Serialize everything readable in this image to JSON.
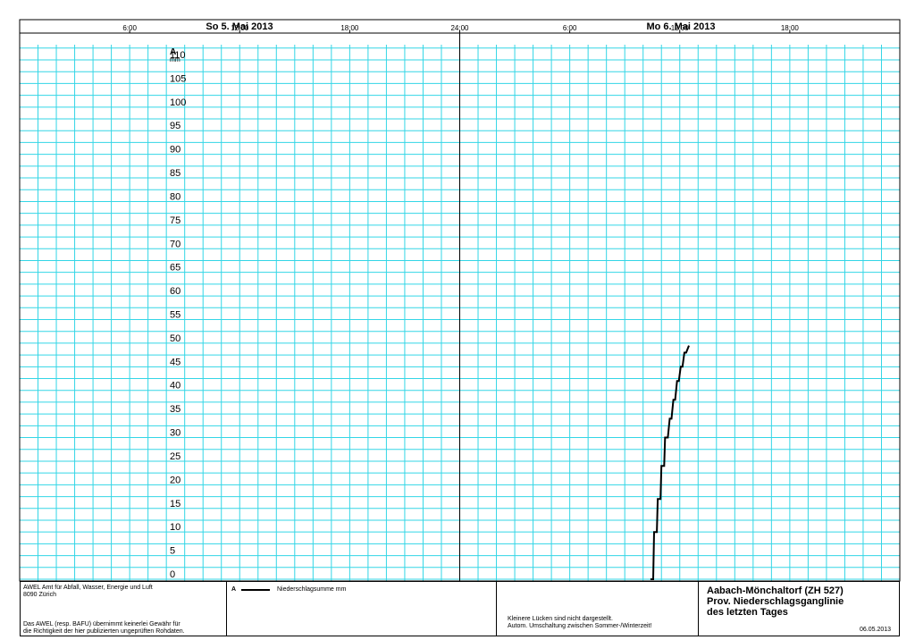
{
  "header": {
    "day1": "So  5. Mai  2013",
    "day2": "Mo  6. Mai  2013",
    "time_labels": [
      "6:00",
      "12:00",
      "18:00",
      "24:00",
      "6:00",
      "12:00",
      "18:00"
    ]
  },
  "colors": {
    "grid": "#33d6e6",
    "line": "#000000"
  },
  "chart_data": {
    "type": "line",
    "series": [
      {
        "name": "Niederschlagsumme mm",
        "x_hours_from_start": [
          34.4,
          34.55,
          34.6,
          34.75,
          34.8,
          34.95,
          35.0,
          35.15,
          35.2,
          35.35,
          35.45,
          35.55,
          35.65,
          35.75,
          35.85,
          35.95,
          36.05,
          36.15,
          36.25,
          36.35,
          36.5
        ],
        "values": [
          0,
          0,
          10,
          10,
          17,
          17,
          24,
          24,
          30,
          30,
          34,
          34,
          38,
          38,
          42,
          42,
          45,
          45,
          48,
          48,
          49.5
        ]
      }
    ],
    "x_range_hours": [
      0,
      48
    ],
    "ylim": [
      0,
      110
    ],
    "ytick_values": [
      0,
      5,
      10,
      15,
      20,
      25,
      30,
      35,
      40,
      45,
      50,
      55,
      60,
      65,
      70,
      75,
      80,
      85,
      90,
      95,
      100,
      105,
      110
    ],
    "ytick_labels": [
      "0",
      "5",
      "10",
      "15",
      "20",
      "25",
      "30",
      "35",
      "40",
      "45",
      "50",
      "55",
      "60",
      "65",
      "70",
      "75",
      "80",
      "85",
      "90",
      "95",
      "100",
      "105",
      "110"
    ],
    "axis_letter": "A",
    "ylabel": "mm",
    "grid": true
  },
  "footer": {
    "org_line1": "AWEL  Amt für Abfall, Wasser, Energie und Luft",
    "org_line2": "8090 Zürich",
    "disclaimer_line1": "Das AWEL (resp. BAFU) übernimmt keinerlei Gewähr für",
    "disclaimer_line2": "die Richtigkeit der hier publizierten ungeprüften Rohdaten.",
    "legend_letter": "A",
    "legend_label": "Niederschlagsumme mm",
    "note_line1": "Kleinere Lücken sind nicht dargestellt.",
    "note_line2": "Autom. Umschaltung zwischen Sommer-/Winterzeit!",
    "station": "Aabach-Mönchaltorf (ZH 527)",
    "title_line1": "Prov. Niederschlagsganglinie",
    "title_line2": "des letzten Tages",
    "date": "06.05.2013"
  }
}
